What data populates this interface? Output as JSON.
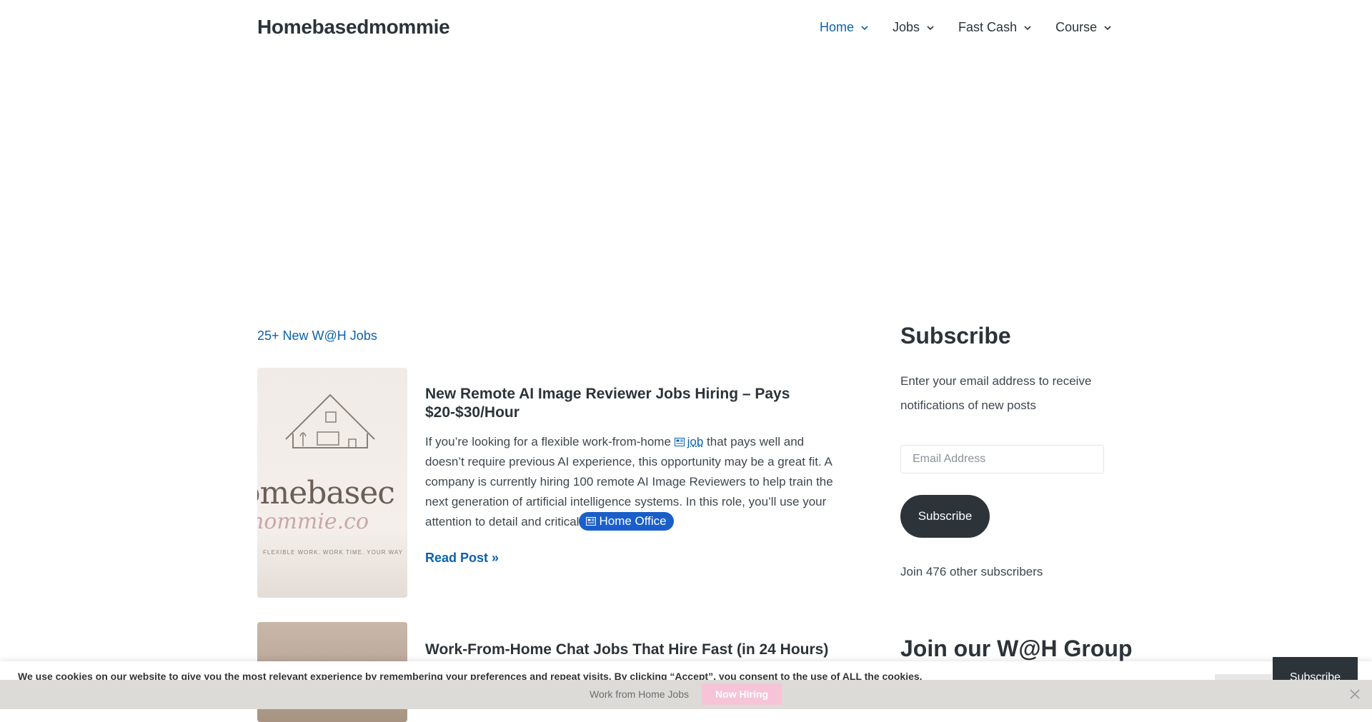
{
  "header": {
    "site_title": "Homebasedmommie",
    "nav": [
      {
        "label": "Home",
        "active": true
      },
      {
        "label": "Jobs",
        "active": false
      },
      {
        "label": "Fast Cash",
        "active": false
      },
      {
        "label": "Course",
        "active": false
      }
    ]
  },
  "main": {
    "category_link": "25+ New W@H Jobs",
    "posts": [
      {
        "title": "New Remote AI Image Reviewer Jobs Hiring – Pays $20-$30/Hour",
        "excerpt_before": "If you’re looking for a flexible work-from-home ",
        "keyword_link": "job",
        "excerpt_after": " that pays well and doesn’t require previous AI experience, this opportunity may be a great fit.  A company is currently hiring 100 remote AI Image Reviewers to help train the next generation of artificial intelligence systems.  In this role, you’ll use your attention to detail and critical",
        "pill_label": "Home Office",
        "read_more": "Read Post »",
        "thumb_text": {
          "line1": "omebasec",
          "line2": "nommie.co",
          "tag": "FLEXIBLE WORK. WORK TIME. YOUR WAY"
        }
      },
      {
        "title": "Work-From-Home Chat Jobs That Hire Fast (in 24 Hours)"
      }
    ]
  },
  "sidebar": {
    "subscribe_title": "Subscribe",
    "description": "Enter your email address to receive notifications of new posts",
    "email_placeholder": "Email Address",
    "subscribe_button": "Subscribe",
    "subscriber_count": "Join 476 other subscribers",
    "group_title": "Join our W@H Group"
  },
  "cookie_bar": {
    "text": "We use cookies on our website to give you the most relevant experience by remembering your preferences and repeat visits. By clicking “Accept”, you consent to the use of ALL the cookies."
  },
  "floating_subscribe": "Subscribe",
  "bottom_bar": {
    "label": "Work from Home Jobs",
    "button": "Now Hiring"
  },
  "colors": {
    "accent": "#0b62ae",
    "dark": "#2c3339",
    "pill": "#1a5fc9",
    "hire_button": "#f6c4d6",
    "bottom_bar": "#dcdbd7"
  }
}
